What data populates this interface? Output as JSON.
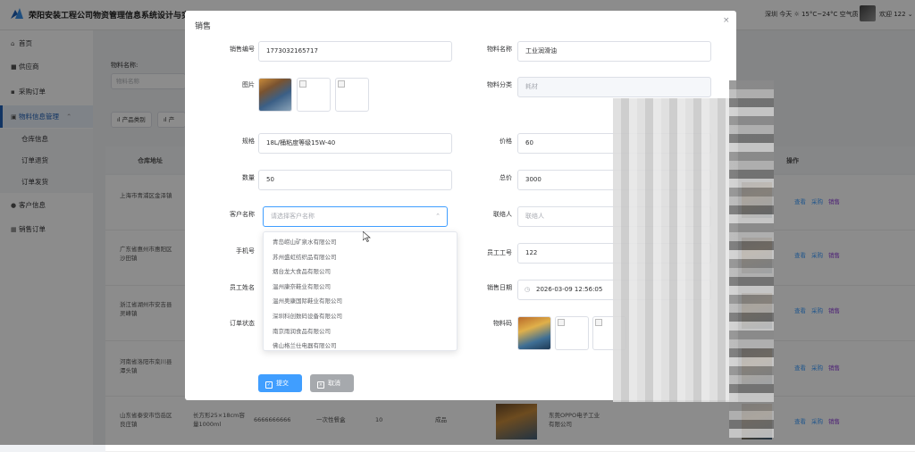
{
  "app": {
    "title": "荣阳安装工程公司物资管理信息系统设计与实现",
    "weather": "深圳 今天 ☼ 15°C~24°C 空气质",
    "user": "欢迎 122 ⌄"
  },
  "sidebar": {
    "items": [
      {
        "label": "首页",
        "icon": "home-icon"
      },
      {
        "label": "供应商",
        "icon": "monitor-icon"
      },
      {
        "label": "采购订单",
        "icon": "cart-icon"
      },
      {
        "label": "物料信息管理",
        "icon": "box-icon"
      },
      {
        "label": "客户信息",
        "icon": "people-icon"
      },
      {
        "label": "销售订单",
        "icon": "grid-icon"
      }
    ],
    "subitems": [
      "仓库信息",
      "订单退货",
      "订单发货"
    ]
  },
  "background": {
    "filter_label": "物料名称:",
    "filter_placeholder": "物料名称",
    "btn_category": "产品类别",
    "btn_other": "产品",
    "col_address": "仓库地址",
    "col_ops": "操作",
    "rows": [
      {
        "address": "上海市青浦区金泽镇"
      },
      {
        "address": "广东省惠州市惠阳区沙田镇"
      },
      {
        "address": "浙江省湖州市安吉县灵峰镇"
      },
      {
        "address": "河南省洛阳市栾川县潭头镇"
      },
      {
        "address": "山东省泰安市岱岳区良庄镇",
        "spec": "长方形25×18cm容量1000ml",
        "code": "6666666666",
        "name": "一次性餐盒",
        "qty": "10",
        "type": "成品",
        "supplier": "东莞OPPO电子工业有限公司"
      }
    ],
    "ops": {
      "view": "查看",
      "buy": "采购",
      "sell": "销售"
    }
  },
  "dialog": {
    "title": "销售",
    "close": "×",
    "fields": {
      "sale_no": {
        "label": "销售编号",
        "value": "1773032165717"
      },
      "material_name": {
        "label": "物料名称",
        "value": "工业润滑油"
      },
      "image": {
        "label": "图片"
      },
      "category": {
        "label": "物料分类",
        "value": "耗材"
      },
      "spec": {
        "label": "规格",
        "value": "18L/桶粘度等级15W-40"
      },
      "price": {
        "label": "价格",
        "value": "60"
      },
      "quantity": {
        "label": "数量",
        "value": "50"
      },
      "total": {
        "label": "总价",
        "value": "3000"
      },
      "customer": {
        "label": "客户名称",
        "placeholder": "请选择客户名称"
      },
      "contact": {
        "label": "联络人",
        "placeholder": "联络人"
      },
      "phone": {
        "label": "手机号"
      },
      "employee_no": {
        "label": "员工工号",
        "value": "122"
      },
      "employee_name": {
        "label": "员工姓名"
      },
      "sale_date": {
        "label": "销售日期",
        "value": "2026-03-09 12:56:05"
      },
      "order_status": {
        "label": "订单状态"
      },
      "material_code": {
        "label": "物料码"
      }
    },
    "customer_options": [
      "青岛崂山矿泉水有限公司",
      "苏州盛虹纺织品有限公司",
      "烟台龙大食品有限公司",
      "温州康奈鞋业有限公司",
      "温州奥康国际鞋业有限公司",
      "深圳科创数码设备有限公司",
      "南京雨润食品有限公司",
      "佛山格兰仕电器有限公司"
    ],
    "submit": "提交",
    "cancel": "取消"
  },
  "colors": {
    "primary": "#409eff",
    "sidebar_active": "#1f5fb4",
    "overlay": "rgba(0,0,0,0.45)"
  }
}
